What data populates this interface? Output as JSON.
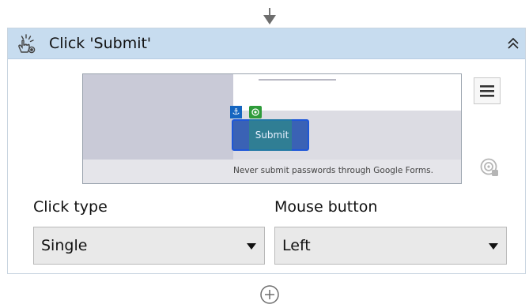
{
  "activity": {
    "title": "Click 'Submit'",
    "icon": "click-activity-icon"
  },
  "preview": {
    "button_label": "Submit",
    "note": "Never submit passwords through Google Forms."
  },
  "properties": {
    "click_type": {
      "label": "Click type",
      "value": "Single"
    },
    "mouse_button": {
      "label": "Mouse button",
      "value": "Left"
    }
  },
  "colors": {
    "header_bg": "#c7dcef",
    "anchor_blue": "#1565c0",
    "target_green": "#2e9b3a",
    "preview_button": "#3a62b5"
  }
}
